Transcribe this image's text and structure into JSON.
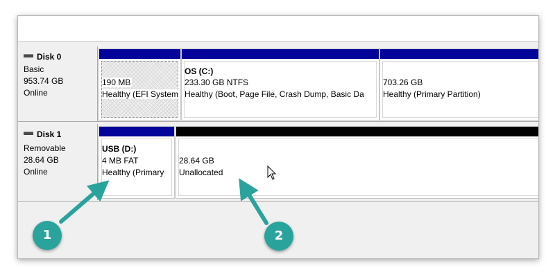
{
  "disks": [
    {
      "name": "Disk 0",
      "type": "Basic",
      "size": "953.74 GB",
      "status": "Online",
      "partitions": [
        {
          "title": "",
          "line1": "190 MB",
          "line2": "Healthy (EFI System"
        },
        {
          "title": "OS  (C:)",
          "line1": "233.30 GB NTFS",
          "line2": "Healthy (Boot, Page File, Crash Dump, Basic Da"
        },
        {
          "title": "",
          "line1": "703.26 GB",
          "line2": "Healthy (Primary Partition)"
        }
      ]
    },
    {
      "name": "Disk 1",
      "type": "Removable",
      "size": "28.64 GB",
      "status": "Online",
      "partitions": [
        {
          "title": "USB  (D:)",
          "line1": "4 MB FAT",
          "line2": "Healthy (Primary"
        },
        {
          "title": "",
          "line1": "28.64 GB",
          "line2": "Unallocated"
        }
      ]
    }
  ],
  "callouts": [
    "1",
    "2"
  ],
  "colors": {
    "primary_partition_bar": "#04049b",
    "unallocated_bar": "#000000",
    "callout": "#2aa39c"
  }
}
